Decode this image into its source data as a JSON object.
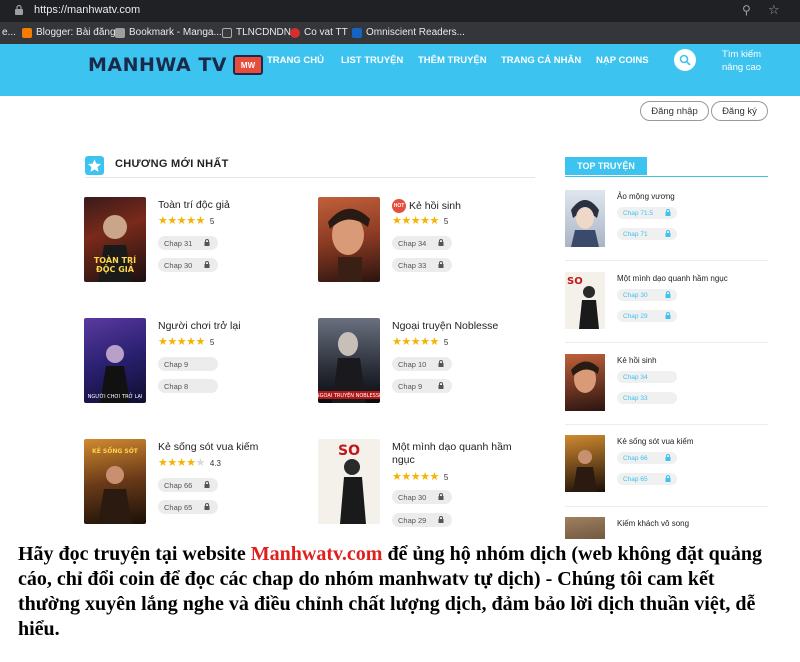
{
  "browser": {
    "url": "https://manhwatv.com",
    "bookmarks": [
      {
        "label": "e...",
        "color": "#888888"
      },
      {
        "label": "Blogger: Bài đăng",
        "color": "#f57c00"
      },
      {
        "label": "Bookmark - Manga...",
        "color": "#9e9e9e"
      },
      {
        "label": "TLNCDNDN",
        "color": "#3a3a3a"
      },
      {
        "label": "Co vat TT",
        "color": "#d32f2f"
      },
      {
        "label": "Omniscient Readers...",
        "color": "#1565c0"
      }
    ]
  },
  "site": {
    "logo": "MANHWA TV",
    "logo_badge": "MW",
    "nav": [
      "TRANG CHỦ",
      "LIST TRUYỆN",
      "THÊM TRUYỆN",
      "TRANG CÁ NHÂN",
      "NẠP COINS"
    ],
    "advanced_search": [
      "Tìm kiếm",
      "nâng cao"
    ],
    "login": "Đăng nhập",
    "register": "Đăng ký"
  },
  "latest": {
    "heading": "CHƯƠNG MỚI NHẤT",
    "items": [
      {
        "title": "Toàn trí độc giả",
        "rating": "5",
        "stars": 5,
        "chapters": [
          "Chap 31",
          "Chap 30"
        ],
        "hot": false
      },
      {
        "title": "Kẻ hồi sinh",
        "rating": "5",
        "stars": 5,
        "chapters": [
          "Chap 34",
          "Chap 33"
        ],
        "hot": true,
        "hot_label": "HOT"
      },
      {
        "title": "Người chơi trở lại",
        "rating": "5",
        "stars": 5,
        "chapters": [
          "Chap 9",
          "Chap 8"
        ],
        "hot": false
      },
      {
        "title": "Ngoại truyện Noblesse",
        "rating": "5",
        "stars": 5,
        "chapters": [
          "Chap 10",
          "Chap 9"
        ],
        "hot": false
      },
      {
        "title": "Kẻ sống sót vua kiếm",
        "rating": "4.3",
        "stars": 4.3,
        "chapters": [
          "Chap 66",
          "Chap 65"
        ],
        "hot": false
      },
      {
        "title": "Một mình dạo quanh hầm ngục",
        "rating": "5",
        "stars": 5,
        "chapters": [
          "Chap 30",
          "Chap 29"
        ],
        "hot": false
      }
    ]
  },
  "top": {
    "heading": "TOP TRUYỆN",
    "items": [
      {
        "title": "Ảo mộng vương",
        "chapters": [
          "Chap 71.5",
          "Chap 71"
        ]
      },
      {
        "title": "Một mình dạo quanh hầm ngục",
        "chapters": [
          "Chap 30",
          "Chap 29"
        ]
      },
      {
        "title": "Kẻ hồi sinh",
        "chapters": [
          "Chap 34",
          "Chap 33"
        ]
      },
      {
        "title": "Kẻ sống sót vua kiếm",
        "chapters": [
          "Chap 66",
          "Chap 65"
        ]
      },
      {
        "title": "Kiếm khách vô song",
        "chapters": []
      }
    ]
  },
  "notice": {
    "lead": "Hãy đọc truyện tại website ",
    "site": "Manhwatv.com",
    "tail": " để ủng hộ nhóm dịch (web không đặt quảng cáo, chỉ đổi coin để đọc các chap do nhóm manhwatv tự dịch) - Chúng tôi cam kết thường xuyên lắng nghe và điều chỉnh chất lượng dịch, đảm bảo lời dịch thuần việt, dễ hiểu."
  },
  "colors": {
    "accent": "#3cc3ef",
    "star": "#f5b301",
    "notice_red": "#e0201c"
  }
}
